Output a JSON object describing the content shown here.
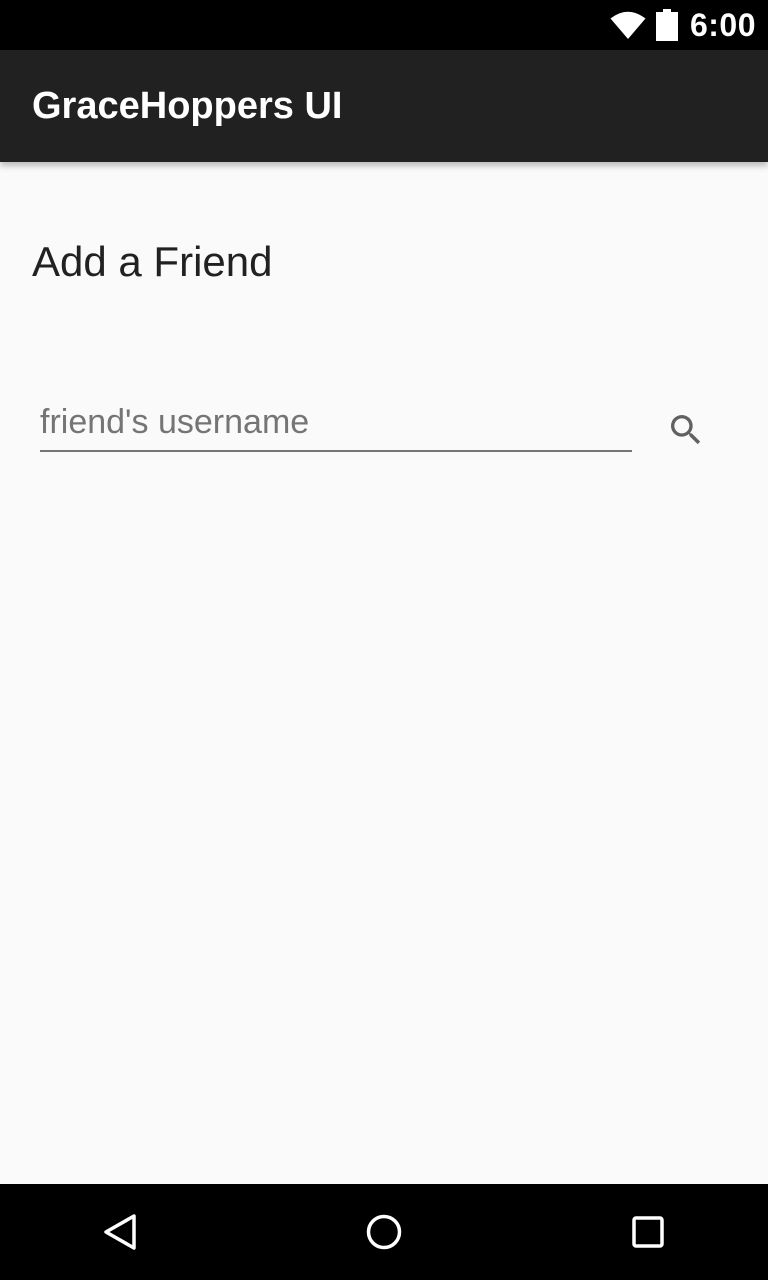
{
  "status_bar": {
    "time": "6:00",
    "icons": [
      "wifi-icon",
      "battery-icon"
    ]
  },
  "toolbar": {
    "title": "GraceHoppers UI",
    "background": "#212121"
  },
  "main": {
    "heading": "Add a Friend",
    "search": {
      "value": "",
      "placeholder": "friend's username",
      "button_icon": "search-icon"
    }
  },
  "nav_bar": {
    "buttons": [
      "back-icon",
      "home-icon",
      "recents-icon"
    ]
  },
  "colors": {
    "status_bar": "#000000",
    "toolbar": "#212121",
    "background": "#fafafa",
    "text_primary": "#212121",
    "text_hint": "#757575"
  }
}
